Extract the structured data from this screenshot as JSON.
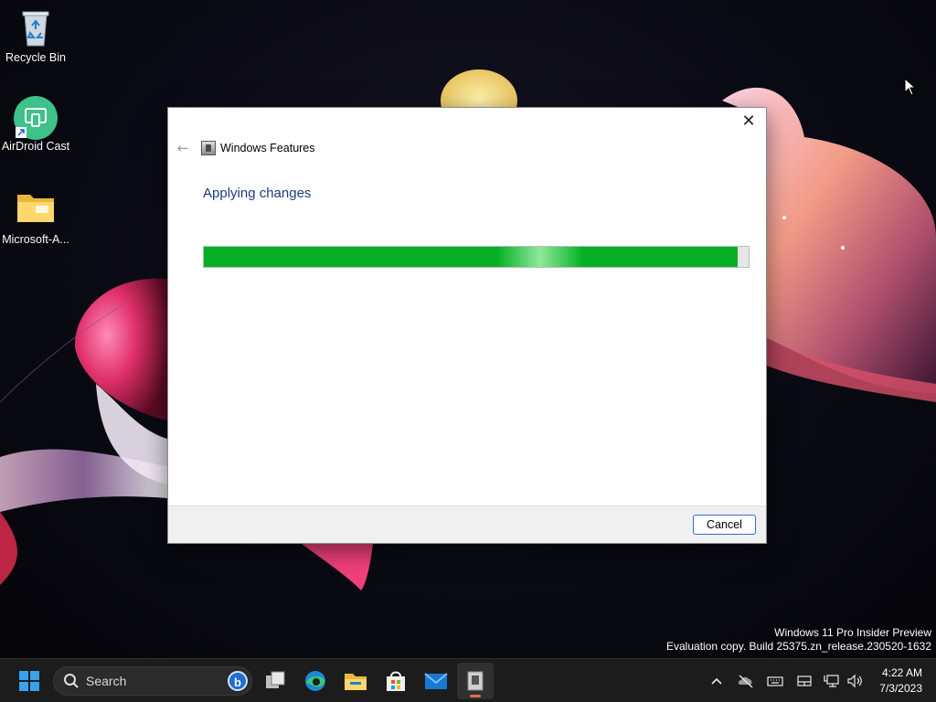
{
  "desktop": {
    "icons": [
      {
        "label": "Recycle Bin",
        "icon": "recycle-bin-icon"
      },
      {
        "label": "AirDroid Cast",
        "icon": "airdroid-cast-icon"
      },
      {
        "label": "Microsoft-A...",
        "icon": "folder-icon"
      }
    ]
  },
  "dialog": {
    "title": "Windows Features",
    "heading": "Applying changes",
    "progress_percent": 98,
    "cancel_label": "Cancel",
    "close_glyph": "✕",
    "back_glyph": "←",
    "accent": "#06b025"
  },
  "watermark": {
    "line1": "Windows 11 Pro Insider Preview",
    "line2": "Evaluation copy. Build 25375.zn_release.230520-1632"
  },
  "taskbar": {
    "search_placeholder": "Search",
    "bing_glyph": "b",
    "apps": [
      "task-view-icon",
      "edge-icon",
      "file-explorer-icon",
      "microsoft-store-icon",
      "mail-icon",
      "windows-features-icon"
    ],
    "tray": {
      "chevron": "^",
      "time": "4:22 AM",
      "date": "7/3/2023"
    }
  }
}
